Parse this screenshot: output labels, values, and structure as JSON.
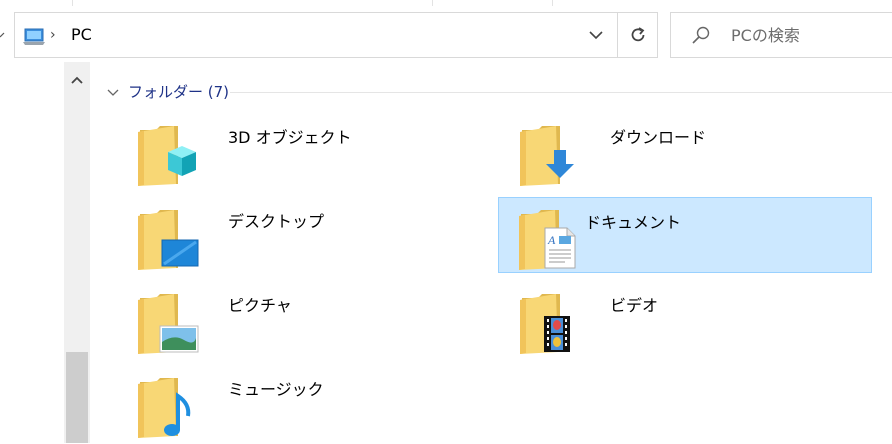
{
  "address": {
    "separator": "›",
    "location": "PC"
  },
  "search": {
    "placeholder": "PCの検索"
  },
  "group": {
    "title": "フォルダー (7)"
  },
  "folders": [
    {
      "label": "3D オブジェクト",
      "icon": "3d-objects-folder-icon"
    },
    {
      "label": "ダウンロード",
      "icon": "downloads-folder-icon"
    },
    {
      "label": "デスクトップ",
      "icon": "desktop-folder-icon"
    },
    {
      "label": "ドキュメント",
      "icon": "documents-folder-icon",
      "selected": true
    },
    {
      "label": "ピクチャ",
      "icon": "pictures-folder-icon"
    },
    {
      "label": "ビデオ",
      "icon": "videos-folder-icon"
    },
    {
      "label": "ミュージック",
      "icon": "music-folder-icon"
    }
  ],
  "colors": {
    "selection_bg": "#cce8ff",
    "selection_border": "#99d1ff",
    "group_title": "#1e3287",
    "folder_yellow": "#f8d775"
  }
}
